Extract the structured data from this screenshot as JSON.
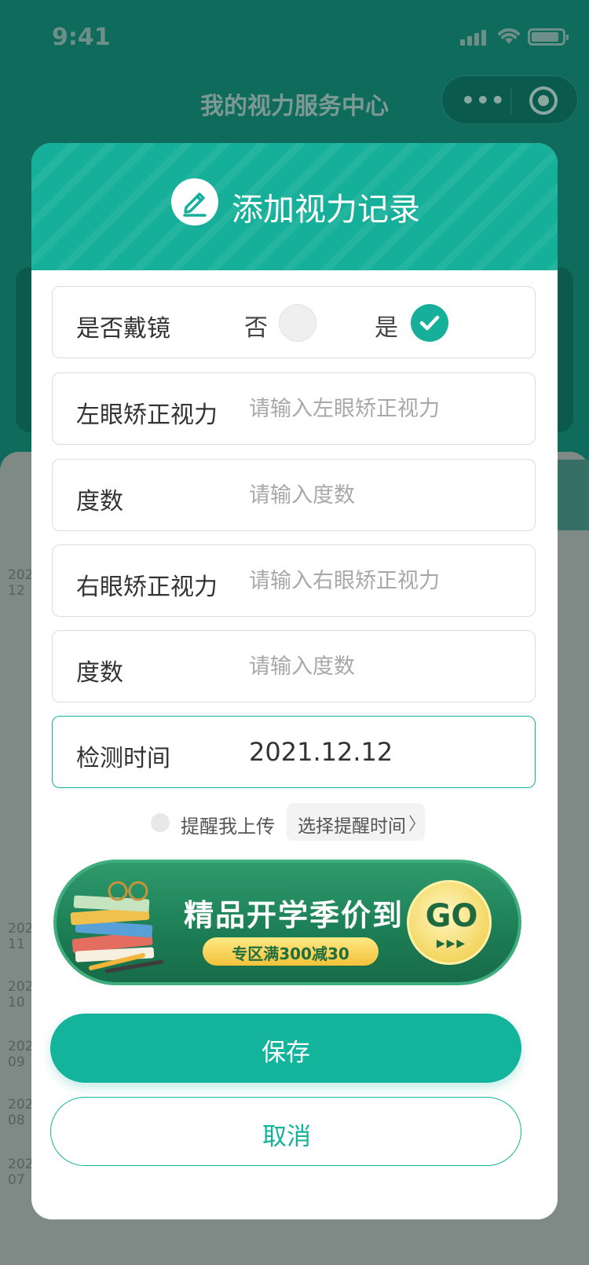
{
  "status_bar": {
    "time": "9:41"
  },
  "nav": {
    "title": "我的视力服务中心"
  },
  "background": {
    "date_labels": [
      {
        "year": "202",
        "month": "12"
      },
      {
        "year": "202",
        "month": "11"
      },
      {
        "year": "202",
        "month": "10"
      },
      {
        "year": "202",
        "month": "09"
      },
      {
        "year": "202",
        "month": "08"
      },
      {
        "year": "202",
        "month": "07"
      }
    ]
  },
  "modal": {
    "title": "添加视力记录",
    "glasses": {
      "label": "是否戴镜",
      "option_no": "否",
      "option_yes": "是",
      "selected": "是"
    },
    "left_vision": {
      "label": "左眼矫正视力",
      "placeholder": "请输入左眼矫正视力"
    },
    "left_degree": {
      "label": "度数",
      "placeholder": "请输入度数"
    },
    "right_vision": {
      "label": "右眼矫正视力",
      "placeholder": "请输入右眼矫正视力"
    },
    "right_degree": {
      "label": "度数",
      "placeholder": "请输入度数"
    },
    "check_time": {
      "label": "检测时间",
      "value": "2021.12.12"
    },
    "remind": {
      "label": "提醒我上传",
      "button": "选择提醒时间",
      "chevron": "〉"
    },
    "banner": {
      "title": "精品开学季价到",
      "subtitle": "专区满300减30",
      "go": "GO",
      "arrows": "▶▶▶"
    },
    "save_label": "保存",
    "cancel_label": "取消"
  },
  "colors": {
    "primary": "#16b09a",
    "banner_green": "#1d7f56",
    "banner_gold": "#f2c23a"
  },
  "icons": {
    "header": "pencil-icon",
    "checked": "check-icon",
    "wifi": "wifi-icon",
    "signal": "signal-icon",
    "battery": "battery-icon"
  }
}
